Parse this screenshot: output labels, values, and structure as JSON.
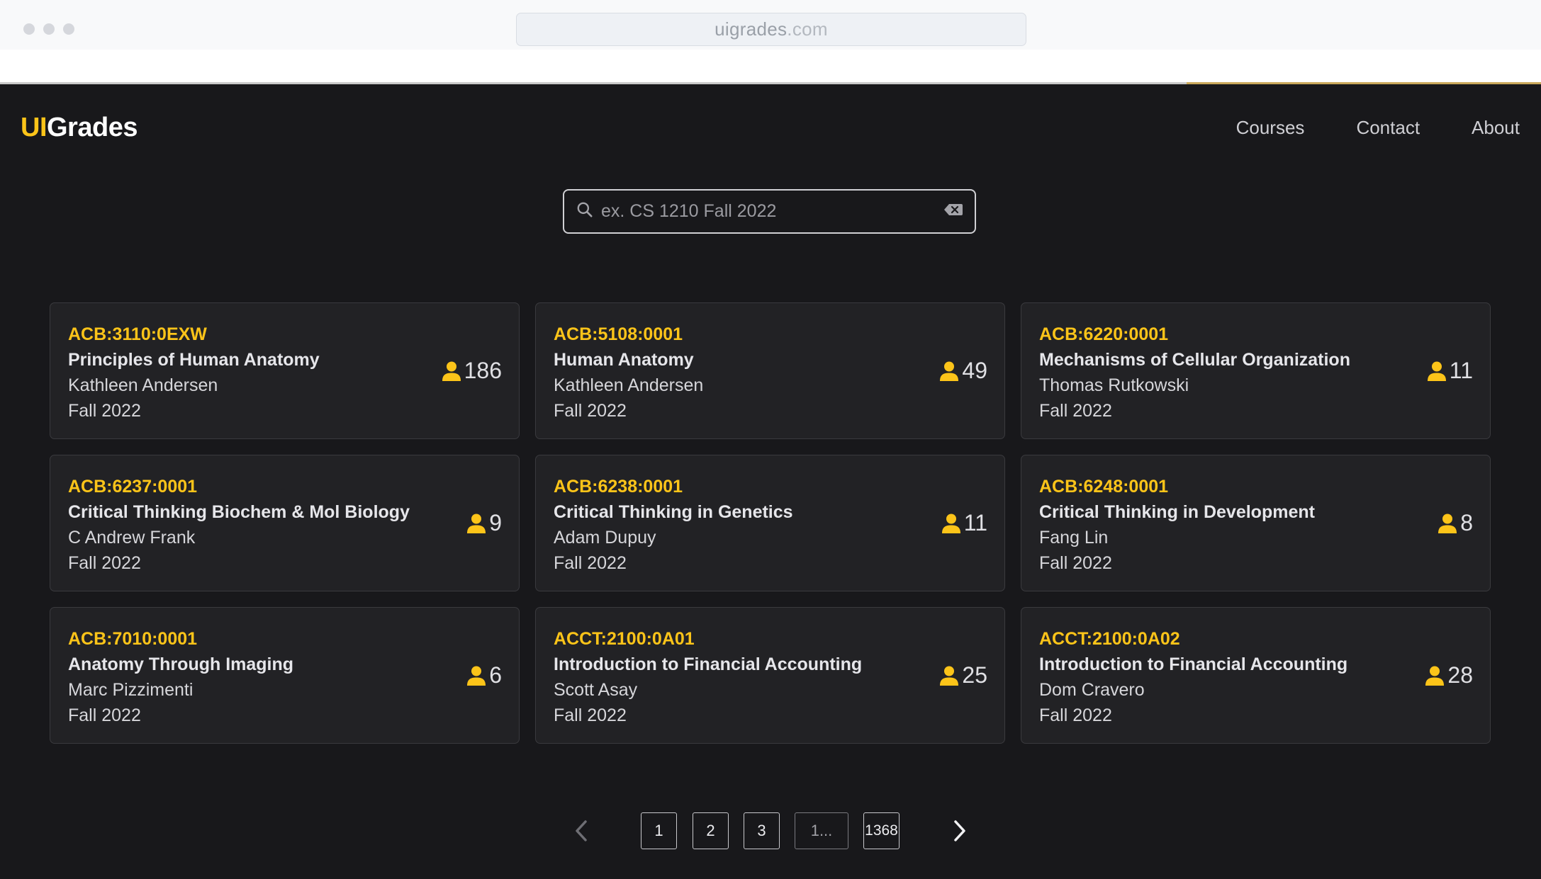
{
  "browser": {
    "url_domain": "uigrades",
    "url_tld": ".com"
  },
  "header": {
    "logo_ui": "UI",
    "logo_grades": "Grades",
    "nav": [
      "Courses",
      "Contact",
      "About"
    ]
  },
  "search": {
    "placeholder": "ex. CS 1210 Fall 2022",
    "value": ""
  },
  "courses": [
    {
      "code": "ACB:3110:0EXW",
      "title": "Principles of Human Anatomy",
      "instructor": "Kathleen Andersen",
      "term": "Fall 2022",
      "students": "186"
    },
    {
      "code": "ACB:5108:0001",
      "title": "Human Anatomy",
      "instructor": "Kathleen Andersen",
      "term": "Fall 2022",
      "students": "49"
    },
    {
      "code": "ACB:6220:0001",
      "title": "Mechanisms of Cellular Organization",
      "instructor": "Thomas Rutkowski",
      "term": "Fall 2022",
      "students": "11"
    },
    {
      "code": "ACB:6237:0001",
      "title": "Critical Thinking Biochem & Mol Biology",
      "instructor": "C Andrew Frank",
      "term": "Fall 2022",
      "students": "9"
    },
    {
      "code": "ACB:6238:0001",
      "title": "Critical Thinking in Genetics",
      "instructor": "Adam Dupuy",
      "term": "Fall 2022",
      "students": "11"
    },
    {
      "code": "ACB:6248:0001",
      "title": "Critical Thinking in Development",
      "instructor": "Fang Lin",
      "term": "Fall 2022",
      "students": "8"
    },
    {
      "code": "ACB:7010:0001",
      "title": "Anatomy Through Imaging",
      "instructor": "Marc Pizzimenti",
      "term": "Fall 2022",
      "students": "6"
    },
    {
      "code": "ACCT:2100:0A01",
      "title": "Introduction to Financial Accounting",
      "instructor": "Scott Asay",
      "term": "Fall 2022",
      "students": "25"
    },
    {
      "code": "ACCT:2100:0A02",
      "title": "Introduction to Financial Accounting",
      "instructor": "Dom Cravero",
      "term": "Fall 2022",
      "students": "28"
    }
  ],
  "pagination": {
    "pages": [
      "1",
      "2",
      "3",
      "1...",
      "1368"
    ]
  },
  "colors": {
    "accent": "#fcc419",
    "background": "#18181b",
    "card": "#222225"
  },
  "icons": [
    "search-icon",
    "clear-icon",
    "person-icon",
    "chevron-left-icon",
    "chevron-right-icon"
  ]
}
